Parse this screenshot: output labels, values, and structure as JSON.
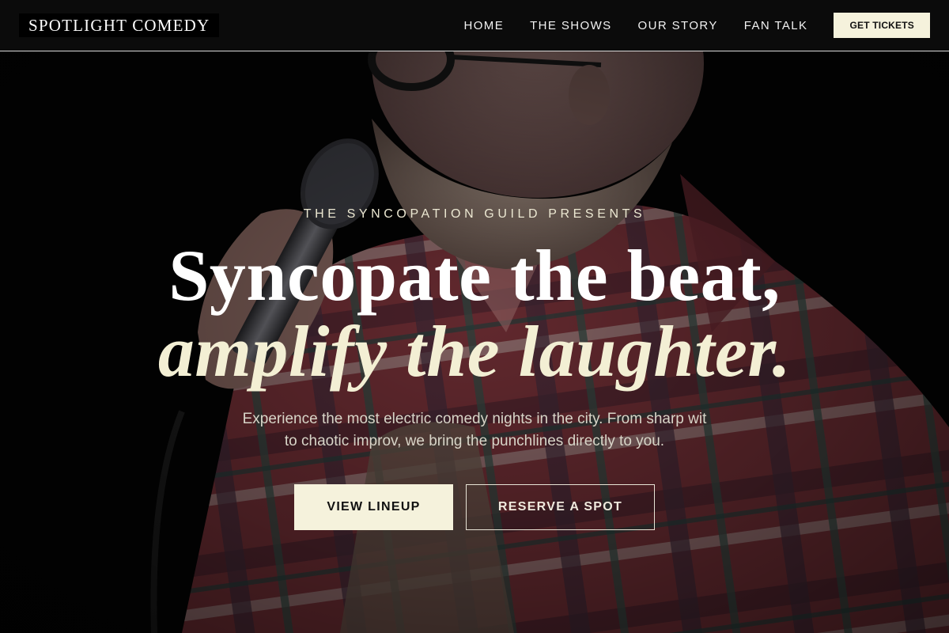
{
  "nav": {
    "brand": "SPOTLIGHT COMEDY",
    "links": [
      "HOME",
      "THE SHOWS",
      "OUR STORY",
      "FAN TALK"
    ],
    "cta": "GET TICKETS"
  },
  "hero": {
    "eyebrow": "THE SYNCOPATION GUILD PRESENTS",
    "headline_line1": "Syncopate the beat,",
    "headline_line2": "amplify the laughter.",
    "subtext_line1": "Experience the most electric comedy nights in the city. From sharp wit",
    "subtext_line2": "to chaotic improv, we bring the punchlines directly to you.",
    "primary_button": "VIEW LINEUP",
    "secondary_button": "RESERVE A SPOT"
  },
  "colors": {
    "accent_cream": "#f5f2dc",
    "navbar_bg": "#0b0b0b",
    "text_light": "#f2f2f2"
  },
  "icons": [
    "comedian-microphone-photo"
  ]
}
